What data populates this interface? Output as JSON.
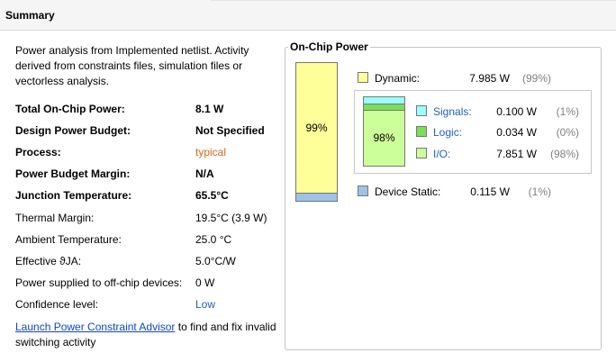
{
  "header": {
    "title": "Summary"
  },
  "description": "Power analysis from Implemented netlist. Activity derived from constraints files, simulation files or vectorless analysis.",
  "summary_rows": [
    {
      "label": "Total On-Chip Power:",
      "value": "8.1 W"
    },
    {
      "label": "Design Power Budget:",
      "value": "Not Specified"
    },
    {
      "label": "Process:",
      "value": "typical"
    },
    {
      "label": "Power Budget Margin:",
      "value": "N/A"
    },
    {
      "label": "Junction Temperature:",
      "value": "65.5°C"
    },
    {
      "label": "Thermal Margin:",
      "value": "19.5°C (3.9 W)"
    },
    {
      "label": "Ambient Temperature:",
      "value": "25.0 °C"
    },
    {
      "label": "Effective ϑJA:",
      "value": "5.0°C/W"
    },
    {
      "label": "Power supplied to off-chip devices:",
      "value": "0 W"
    },
    {
      "label": "Confidence level:",
      "value": "Low"
    }
  ],
  "footer": {
    "link_text": "Launch Power Constraint Advisor",
    "rest_text": " to find and fix invalid switching activity"
  },
  "on_chip": {
    "title": "On-Chip Power",
    "big_bar_percent_label": "99%",
    "small_bar_percent_label": "98%",
    "dynamic": {
      "label": "Dynamic:",
      "value": "7.985 W",
      "pct": "(99%)",
      "color": "#ffff99"
    },
    "device_static": {
      "label": "Device Static:",
      "value": "0.115 W",
      "pct": "(1%)",
      "color": "#9dc3e6"
    },
    "breakdown": [
      {
        "label": "Signals:",
        "value": "0.100 W",
        "pct": "(1%)",
        "color": "#99ffff"
      },
      {
        "label": "Logic:",
        "value": "0.034 W",
        "pct": "(0%)",
        "color": "#7ddd58"
      },
      {
        "label": "I/O:",
        "value": "7.851 W",
        "pct": "(98%)",
        "color": "#ccff99"
      }
    ]
  },
  "colors": {
    "link": "#1144cc",
    "process_value": "#d2691e",
    "confidence_value": "#1f5fbf",
    "pct_gray": "#808080"
  }
}
